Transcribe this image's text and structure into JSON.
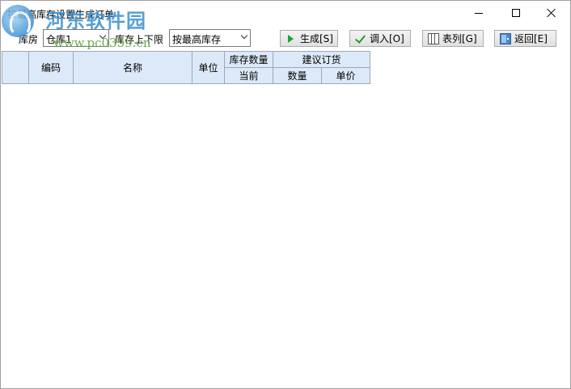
{
  "window": {
    "title": "按最高库存设置生成订单",
    "controls": {
      "minimize_icon": "minimize-icon",
      "maximize_icon": "maximize-icon",
      "close_icon": "close-icon"
    }
  },
  "watermark": {
    "name": "河东软件园",
    "url": "www.pc0359.cn"
  },
  "toolbar": {
    "warehouse_label": "库房",
    "warehouse_value": "仓库1",
    "limit_label": "库存上下限",
    "limit_value": "按最高库存",
    "buttons": [
      {
        "label": "生成[S]",
        "icon": "play-icon"
      },
      {
        "label": "调入[O]",
        "icon": "check-icon"
      },
      {
        "label": "表列[G]",
        "icon": "columns-icon"
      },
      {
        "label": "返回[E]",
        "icon": "door-exit-icon"
      }
    ]
  },
  "grid": {
    "headers": {
      "code": "编码",
      "name": "名称",
      "unit": "单位",
      "stock_qty": "库存数量",
      "suggest_order": "建议订货",
      "current": "当前",
      "qty": "数量",
      "price": "单价"
    },
    "rows": []
  },
  "colors": {
    "header_bg": "#dce9f8",
    "grid_border": "#9aa8b8",
    "watermark_blue": "#3b8fd0",
    "watermark_green": "#5aa33a"
  }
}
